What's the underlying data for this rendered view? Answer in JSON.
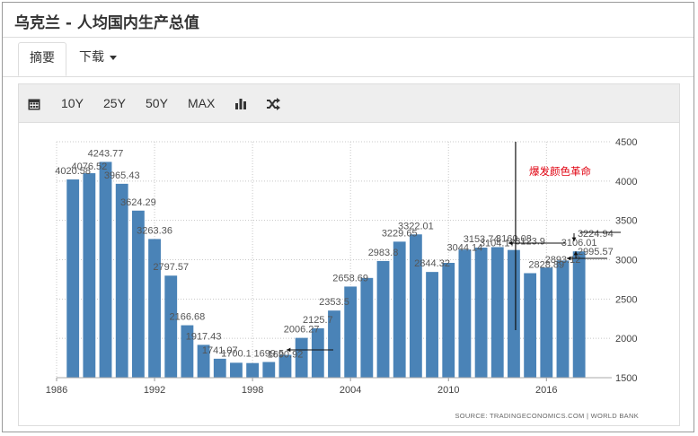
{
  "title": "乌克兰 - 人均国内生产总值",
  "tabs": [
    {
      "label": "摘要",
      "active": true
    },
    {
      "label": "下载",
      "active": false
    }
  ],
  "toolbar": {
    "calendar_icon": "calendar-icon",
    "ranges": [
      "10Y",
      "25Y",
      "50Y",
      "MAX"
    ],
    "bar_icon": "bar-chart-icon",
    "shuffle_icon": "shuffle-icon"
  },
  "annotation": "爆发颜色革命",
  "source": "SOURCE: TRADINGECONOMICS.COM | WORLD BANK",
  "colors": {
    "bar": "#4a83b7",
    "annotation": "#e0000f",
    "grid": "#c8c8c8",
    "text": "#555555"
  },
  "chart_data": {
    "type": "bar",
    "title": "乌克兰 - 人均国内生产总值",
    "x_ticks": [
      "1986",
      "1992",
      "1998",
      "2004",
      "2010",
      "2016"
    ],
    "y_ticks": [
      "1500",
      "2000",
      "2500",
      "3000",
      "3500",
      "4000",
      "4500"
    ],
    "ylim": [
      1500,
      4500
    ],
    "xlim": [
      1986,
      2020
    ],
    "y_axis_position": "right",
    "grid": "dotted",
    "categories": [
      1987,
      1988,
      1989,
      1990,
      1991,
      1992,
      1993,
      1994,
      1995,
      1996,
      1997,
      1998,
      1999,
      2000,
      2001,
      2002,
      2003,
      2004,
      2005,
      2006,
      2007,
      2008,
      2009,
      2010,
      2011,
      2012,
      2013,
      2014,
      2015,
      2016,
      2017,
      2018
    ],
    "values": [
      4020.58,
      4100,
      4243.77,
      3965.43,
      3624.29,
      3263.36,
      2797.57,
      2166.68,
      1917.43,
      1741.07,
      1690,
      1686,
      1699.5,
      1790,
      2006.27,
      2128,
      2353.5,
      2658.69,
      2768,
      2983.8,
      3229.65,
      3322.01,
      2844.32,
      2960,
      3129,
      3153.74,
      3160.08,
      3123.9,
      2828.89,
      2900,
      2990,
      3106.01
    ],
    "labels": [
      {
        "year": 1987,
        "text": "4020.58"
      },
      {
        "year": 1988,
        "text": "4076.52"
      },
      {
        "year": 1989,
        "text": "4243.77"
      },
      {
        "year": 1990,
        "text": "3965.43"
      },
      {
        "year": 1991,
        "text": "3624.29"
      },
      {
        "year": 1992,
        "text": "3263.36"
      },
      {
        "year": 1993,
        "text": "2797.57"
      },
      {
        "year": 1994,
        "text": "2166.68"
      },
      {
        "year": 1995,
        "text": "1917.43"
      },
      {
        "year": 1996,
        "text": "1741.07"
      },
      {
        "year": 1997,
        "text": "1700.1"
      },
      {
        "year": 1999,
        "text": "1699.5"
      },
      {
        "year": 2000,
        "text": "1690.92"
      },
      {
        "year": 2001,
        "text": "2006.27"
      },
      {
        "year": 2002,
        "text": "2125.7"
      },
      {
        "year": 2003,
        "text": "2353.5"
      },
      {
        "year": 2004,
        "text": "2658.69"
      },
      {
        "year": 2006,
        "text": "2983.8"
      },
      {
        "year": 2007,
        "text": "3229.65"
      },
      {
        "year": 2008,
        "text": "3322.01"
      },
      {
        "year": 2009,
        "text": "2844.32"
      },
      {
        "year": 2011,
        "text": "3044.14"
      },
      {
        "year": 2012,
        "text": "3153.74"
      },
      {
        "year": 2013,
        "text": "3104.17"
      },
      {
        "year": 2014,
        "text": "3160.08"
      },
      {
        "year": 2015,
        "text": "3123.9"
      },
      {
        "year": 2016,
        "text": "2828.89"
      },
      {
        "year": 2017,
        "text": "2893.12"
      },
      {
        "year": 2018,
        "text": "3106.01"
      },
      {
        "year": 2019,
        "text": "2995.57"
      },
      {
        "year": 2019,
        "text": "3224.94"
      }
    ]
  }
}
